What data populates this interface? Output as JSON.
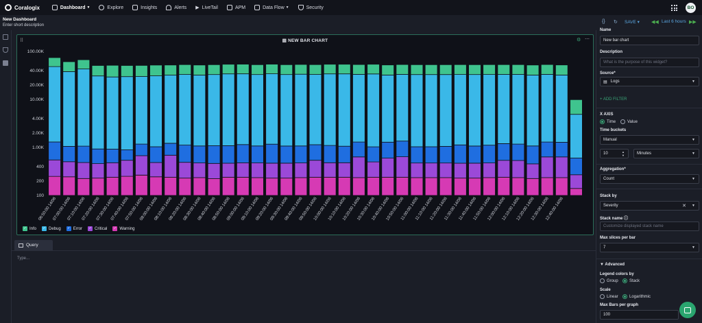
{
  "app": {
    "name": "Coralogix"
  },
  "nav": {
    "items": [
      {
        "label": "Dashboard",
        "active": true,
        "icon": "dashboard-icon",
        "dropdown": true
      },
      {
        "label": "Explore",
        "icon": "explore-icon"
      },
      {
        "label": "Insights",
        "icon": "insights-icon"
      },
      {
        "label": "Alerts",
        "icon": "bell-icon"
      },
      {
        "label": "LiveTail",
        "icon": "play-icon"
      },
      {
        "label": "APM",
        "icon": "apm-icon"
      },
      {
        "label": "Data Flow",
        "icon": "dataflow-icon",
        "dropdown": true
      },
      {
        "label": "Security",
        "icon": "shield-icon"
      }
    ],
    "avatar": "BO"
  },
  "header": {
    "title": "New Dashboard",
    "description": "Enter short description",
    "save": "SAVE",
    "time_range": "Last 6 hours"
  },
  "widget": {
    "title": "NEW BAR CHART"
  },
  "chart_data": {
    "type": "bar",
    "stacked": true,
    "scale": "logarithmic",
    "ylim": [
      100,
      100000
    ],
    "yticks": [
      "100.00K",
      "40.00K",
      "20.00K",
      "10.00K",
      "4.00K",
      "2.00K",
      "1.00K",
      "400",
      "200",
      "100"
    ],
    "categories": [
      "06:50:00 14/06",
      "07:00:00 14/06",
      "07:10:00 14/06",
      "07:20:00 14/06",
      "07:30:00 14/06",
      "07:40:00 14/06",
      "07:50:00 14/06",
      "08:00:00 14/06",
      "08:10:00 14/06",
      "08:20:00 14/06",
      "08:30:00 14/06",
      "08:40:00 14/06",
      "08:50:00 14/06",
      "09:00:00 14/06",
      "09:10:00 14/06",
      "09:20:00 14/06",
      "09:30:00 14/06",
      "09:40:00 14/06",
      "09:50:00 14/06",
      "10:00:00 14/06",
      "10:10:00 14/06",
      "10:20:00 14/06",
      "10:30:00 14/06",
      "10:40:00 14/06",
      "10:50:00 14/06",
      "11:00:00 14/06",
      "11:10:00 14/06",
      "11:20:00 14/06",
      "11:30:00 14/06",
      "11:40:00 14/06",
      "11:50:00 14/06",
      "12:00:00 14/06",
      "12:10:00 14/06",
      "12:20:00 14/06",
      "12:30:00 14/06",
      "12:40:00 14/06"
    ],
    "series": [
      {
        "name": "Warning",
        "color": "#d63ab4",
        "values": [
          250,
          245,
          225,
          230,
          240,
          250,
          265,
          245,
          240,
          230,
          235,
          225,
          240,
          240,
          235,
          230,
          230,
          235,
          240,
          240,
          240,
          235,
          240,
          240,
          240,
          235,
          235,
          235,
          230,
          230,
          235,
          240,
          235,
          225,
          235,
          235,
          140
        ]
      },
      {
        "name": "Critical",
        "color": "#9b49d8",
        "values": [
          300,
          260,
          260,
          230,
          240,
          290,
          410,
          240,
          450,
          260,
          240,
          240,
          230,
          240,
          240,
          240,
          240,
          240,
          300,
          240,
          240,
          400,
          260,
          360,
          400,
          240,
          240,
          240,
          240,
          240,
          240,
          300,
          300,
          230,
          400,
          400,
          130
        ]
      },
      {
        "name": "Error",
        "color": "#1f6ee0",
        "values": [
          750,
          550,
          580,
          470,
          440,
          350,
          500,
          550,
          530,
          630,
          600,
          620,
          620,
          670,
          600,
          700,
          600,
          600,
          600,
          620,
          580,
          660,
          530,
          690,
          720,
          560,
          560,
          580,
          660,
          600,
          640,
          660,
          640,
          620,
          660,
          650,
          330
        ]
      },
      {
        "name": "Debug",
        "color": "#3ab8e8",
        "values": [
          47000,
          37000,
          42000,
          30000,
          28500,
          29000,
          29000,
          30000,
          31000,
          32000,
          31000,
          32000,
          33000,
          33000,
          32000,
          33000,
          32000,
          32500,
          32000,
          33000,
          33000,
          32000,
          33000,
          31000,
          32000,
          32000,
          32000,
          32000,
          32000,
          32000,
          32000,
          32000,
          32000,
          31000,
          32000,
          31000,
          4300
        ]
      },
      {
        "name": "Info",
        "color": "#3fc48e",
        "values": [
          26000,
          23000,
          24000,
          20000,
          22000,
          21000,
          21000,
          21000,
          20000,
          20000,
          20000,
          20000,
          20000,
          20000,
          20000,
          20000,
          20000,
          20000,
          20000,
          20000,
          20000,
          20000,
          20000,
          20000,
          20000,
          20000,
          20000,
          20000,
          20000,
          20000,
          20000,
          20000,
          20000,
          20000,
          20000,
          20000,
          5000
        ]
      }
    ],
    "legend": [
      "Info",
      "Debug",
      "Error",
      "Critical",
      "Warning"
    ],
    "legend_position": "bottom-left"
  },
  "query": {
    "tab": "Query",
    "placeholder": "Type..."
  },
  "panel": {
    "name_label": "Name",
    "name_value": "New bar chart",
    "description_label": "Description",
    "description_placeholder": "What is the purpose of this widget?",
    "source_label": "Source*",
    "source_value": "Logs",
    "add_filter": "+ ADD FILTER",
    "xaxis_label": "X AXIS",
    "xaxis_time": "Time",
    "xaxis_value": "Value",
    "time_buckets_label": "Time buckets",
    "time_buckets_value": "Manual",
    "bucket_number": "10",
    "bucket_unit": "Minutes",
    "aggregation_label": "Aggregation*",
    "aggregation_value": "Count",
    "stack_by_label": "Stack by",
    "stack_by_value": "Severity",
    "stack_name_label": "Stack name",
    "stack_name_placeholder": "Customize displayed stack name",
    "max_slices_label": "Max slices per bar",
    "max_slices_value": "7",
    "advanced_label": "Advanced",
    "legend_colors_label": "Legend colors by",
    "legend_group": "Group",
    "legend_stack": "Stack",
    "scale_label": "Scale",
    "scale_linear": "Linear",
    "scale_log": "Logarithmic",
    "max_bars_label": "Max Bars per graph",
    "max_bars_value": "100"
  }
}
